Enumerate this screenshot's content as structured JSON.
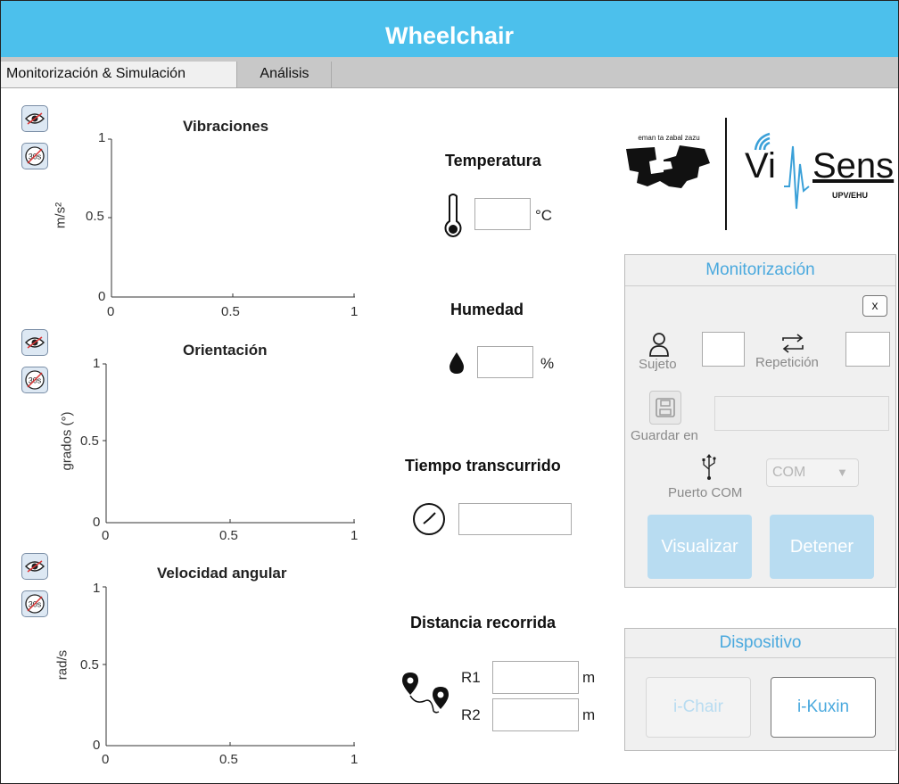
{
  "window": {
    "title": "Wheelchair"
  },
  "tabs": [
    {
      "label": "Monitorización & Simulación",
      "active": true
    },
    {
      "label": "Análisis",
      "active": false
    }
  ],
  "buttons": {
    "view_icon": "eye-icon",
    "timer_off_icon": "30s-off-icon",
    "timer_label": "30s"
  },
  "charts": [
    {
      "title": "Vibraciones",
      "ylabel": "m/s²",
      "yticks": [
        "1",
        "0.5",
        "0"
      ],
      "xticks": [
        "0",
        "0.5",
        "1"
      ]
    },
    {
      "title": "Orientación",
      "ylabel": "grados (°)",
      "yticks": [
        "1",
        "0.5",
        "0"
      ],
      "xticks": [
        "0",
        "0.5",
        "1"
      ]
    },
    {
      "title": "Velocidad angular",
      "ylabel": "rad/s",
      "yticks": [
        "1",
        "0.5",
        "0"
      ],
      "xticks": [
        "0",
        "0.5",
        "1"
      ]
    }
  ],
  "chart_data": [
    {
      "type": "line",
      "title": "Vibraciones",
      "xlabel": "",
      "ylabel": "m/s²",
      "xlim": [
        0,
        1
      ],
      "ylim": [
        0,
        1
      ],
      "series": []
    },
    {
      "type": "line",
      "title": "Orientación",
      "xlabel": "",
      "ylabel": "grados (°)",
      "xlim": [
        0,
        1
      ],
      "ylim": [
        0,
        1
      ],
      "series": []
    },
    {
      "type": "line",
      "title": "Velocidad angular",
      "xlabel": "",
      "ylabel": "rad/s",
      "xlim": [
        0,
        1
      ],
      "ylim": [
        0,
        1
      ],
      "series": []
    }
  ],
  "sensors": {
    "temperature": {
      "title": "Temperatura",
      "value": "",
      "unit": "°C",
      "icon": "thermometer-icon"
    },
    "humidity": {
      "title": "Humedad",
      "value": "",
      "unit": "%",
      "icon": "droplet-icon"
    },
    "elapsed": {
      "title": "Tiempo transcurrido",
      "value": "",
      "icon": "clock-icon"
    },
    "distance": {
      "title": "Distancia recorrida",
      "icon": "route-pins-icon",
      "r1_label": "R1",
      "r1_value": "",
      "r1_unit": "m",
      "r2_label": "R2",
      "r2_value": "",
      "r2_unit": "m"
    }
  },
  "logos": {
    "upv_caption": "eman ta zabal zazu",
    "vi_text": "Vi",
    "sens_text": "Sens",
    "sub_text": "UPV/EHU"
  },
  "monitor": {
    "title": "Monitorización",
    "close_label": "x",
    "subject_label": "Sujeto",
    "subject_value": "",
    "repetition_label": "Repetición",
    "repetition_value": "",
    "save_label": "Guardar en",
    "save_path": "",
    "port_label": "Puerto COM",
    "port_selected": "COM",
    "visualize_label": "Visualizar",
    "stop_label": "Detener"
  },
  "device": {
    "title": "Dispositivo",
    "ichair_label": "i-Chair",
    "ikuxin_label": "i-Kuxin"
  },
  "colors": {
    "accent": "#4cc0ec",
    "panel": "#f0f0f0",
    "disabled_button": "#b6dbf0",
    "panel_title": "#4aa9de"
  }
}
